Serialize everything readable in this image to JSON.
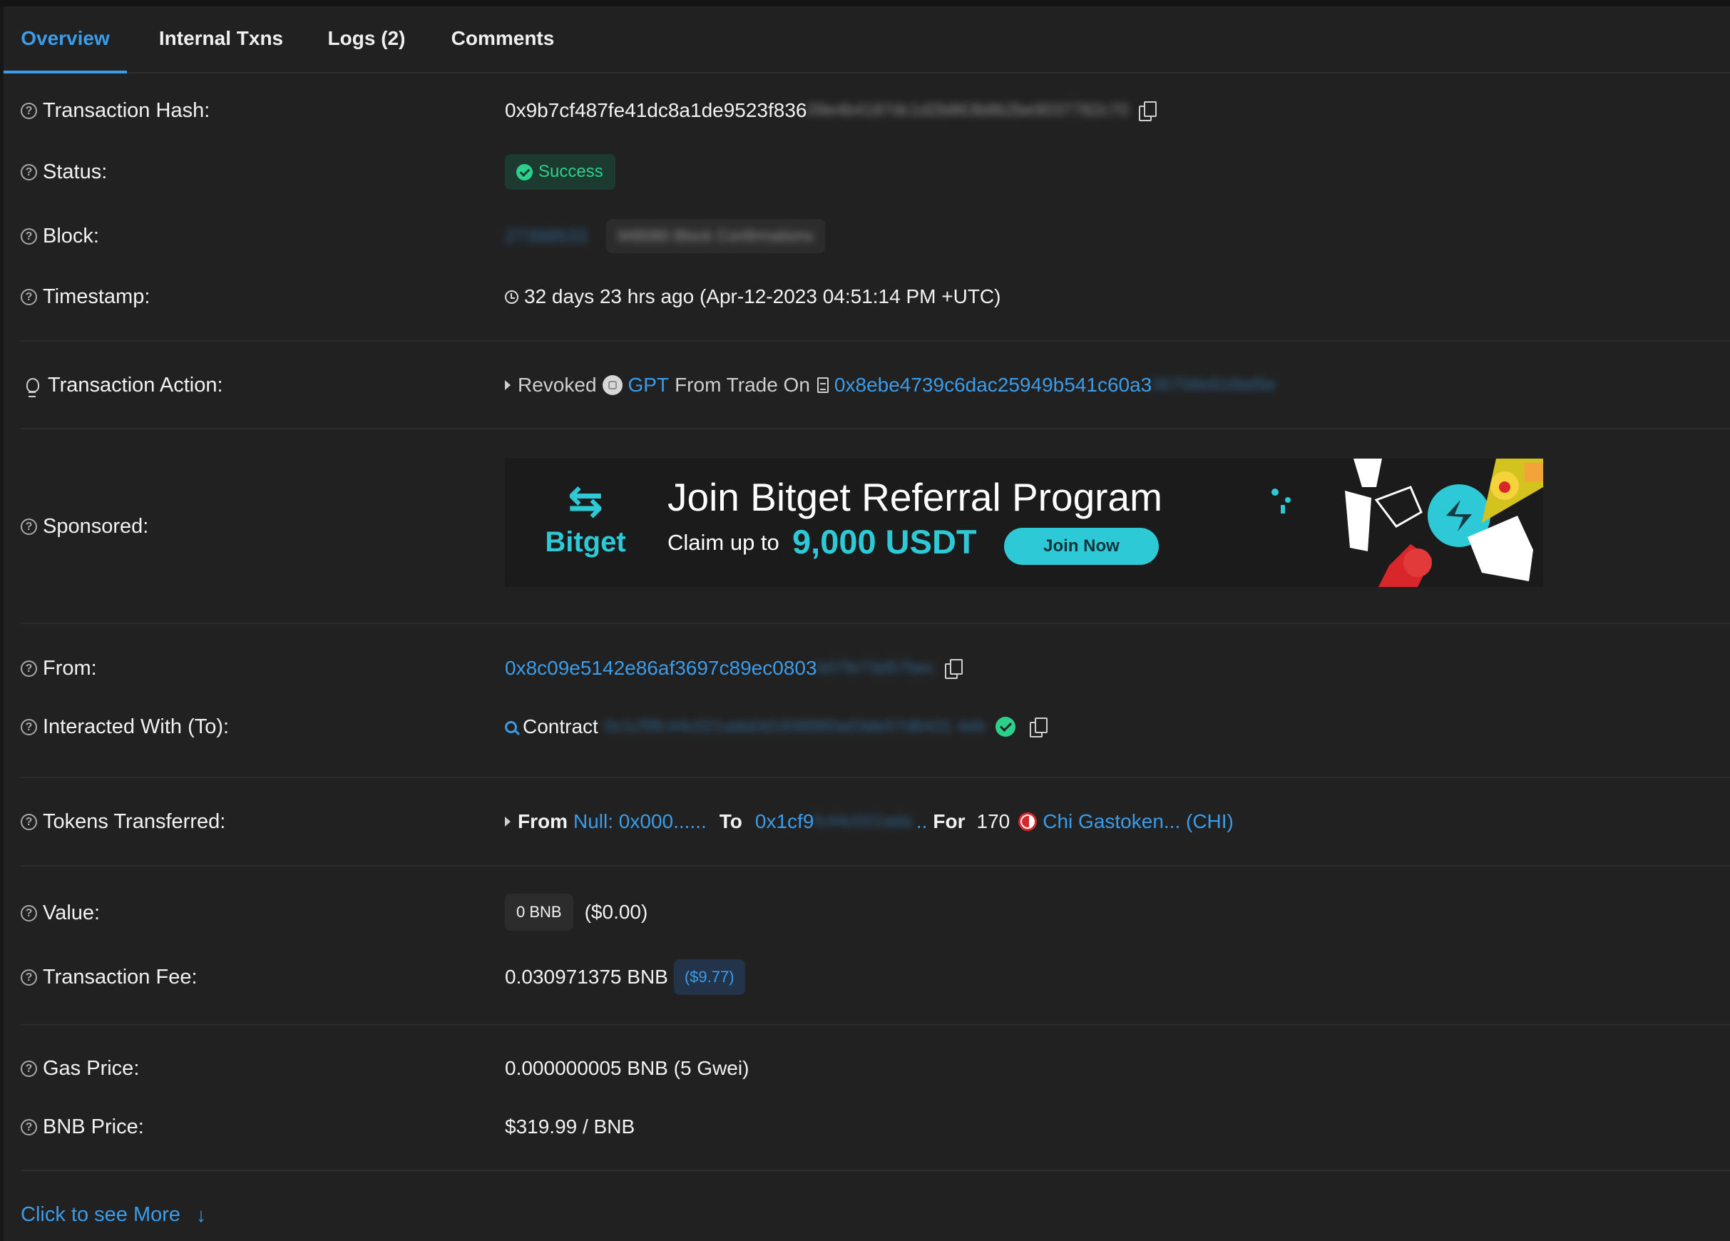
{
  "tabs": {
    "overview": "Overview",
    "internal_txns": "Internal Txns",
    "logs": "Logs (2)",
    "comments": "Comments"
  },
  "rows": {
    "tx_hash": {
      "label": "Transaction Hash:",
      "value": "0x9b7cf487fe41dc8a1de9523f836",
      "value_obscured": "09e4b4187dc1d2b863b8b2be9037782c70"
    },
    "status": {
      "label": "Status:",
      "value": "Success"
    },
    "block": {
      "label": "Block:",
      "value_obscured": "27398533",
      "confirmations_obscured": "948080 Block Confirmations"
    },
    "timestamp": {
      "label": "Timestamp:",
      "value": "32 days 23 hrs ago (Apr-12-2023 04:51:14 PM +UTC)"
    },
    "tx_action": {
      "label": "Transaction Action:",
      "verb": "Revoked",
      "token": "GPT",
      "middle": "From Trade On",
      "address": "0x8ebe4739c6dac25949b541c60a3",
      "address_obscured": "06758e816bd5e"
    },
    "sponsored": {
      "label": "Sponsored:",
      "banner": {
        "logo_text": "Bitget",
        "title": "Join Bitget Referral Program",
        "claim_prefix": "Claim up to",
        "amount": "9,000 USDT",
        "button": "Join Now"
      }
    },
    "from": {
      "label": "From:",
      "value": "0x8c09e5142e86af3697c89ec0803",
      "value_obscured": "b07fe73d57bec"
    },
    "interacted": {
      "label": "Interacted With (To):",
      "prefix": "Contract",
      "address_obscured": "0x1cf9fc44c021ada0d1838980a03de57d6431 4eb"
    },
    "tokens": {
      "label": "Tokens Transferred:",
      "from_label": "From",
      "from_value": "Null: 0x000......",
      "to_label": "To",
      "to_value": "0x1cf9",
      "to_obscured": "fc44c021ada",
      "to_suffix": "..",
      "for_label": "For",
      "amount": "170",
      "token_name": "Chi Gastoken... (CHI)"
    },
    "value": {
      "label": "Value:",
      "amount": "0 BNB",
      "usd": "($0.00)"
    },
    "fee": {
      "label": "Transaction Fee:",
      "amount": "0.030971375 BNB",
      "usd": "($9.77)"
    },
    "gas_price": {
      "label": "Gas Price:",
      "value": "0.000000005 BNB (5 Gwei)"
    },
    "bnb_price": {
      "label": "BNB Price:",
      "value": "$319.99 / BNB"
    }
  },
  "more": {
    "label": "Click to see More"
  },
  "colors": {
    "background": "#212121",
    "link": "#3b9ce9",
    "success": "#2bd18a",
    "brand_accent": "#2ec9d6"
  },
  "icons": {
    "help": "question-circle-icon",
    "copy": "copy-icon",
    "clock": "clock-icon",
    "bulb": "lightbulb-icon",
    "verified": "check-circle-icon",
    "arrow": "arrow-down-icon"
  }
}
